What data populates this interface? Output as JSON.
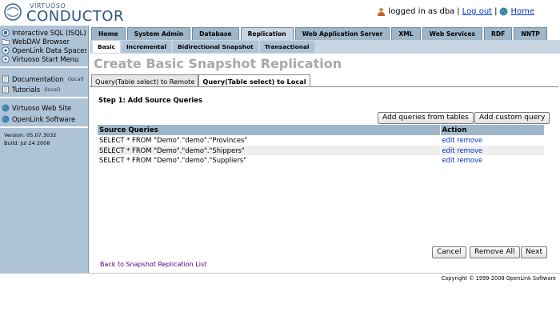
{
  "header": {
    "logo_small": "VIRTUOSO",
    "logo_big": "CONDUCTOR",
    "logged_in_text": "logged in as dba",
    "separator1": "|",
    "logout_label": "Log out",
    "separator2": "|",
    "home_label": "Home"
  },
  "sidebar": {
    "group1": [
      {
        "label": "Interactive SQL (ISQL)",
        "icon": "isql-icon"
      },
      {
        "label": "WebDAV Browser",
        "icon": "folder-icon"
      },
      {
        "label": "OpenLink Data Spaces",
        "icon": "dataspaces-icon"
      },
      {
        "label": "Virtuoso Start Menu",
        "icon": "start-menu-icon"
      }
    ],
    "group2": [
      {
        "label": "Documentation",
        "suffix": "(local)",
        "icon": "docs-icon"
      },
      {
        "label": "Tutorials",
        "suffix": "(local)",
        "icon": "tutorials-icon"
      }
    ],
    "group3": [
      {
        "label": "Virtuoso Web Site",
        "icon": "globe-icon"
      },
      {
        "label": "OpenLink Software",
        "icon": "globe-icon"
      }
    ],
    "version": "Version: 05.07.3032",
    "build": "Build: Jul 24 2008"
  },
  "main_tabs": [
    "Home",
    "System Admin",
    "Database",
    "Replication",
    "Web Application Server",
    "XML",
    "Web Services",
    "RDF",
    "NNTP"
  ],
  "main_tab_active": "Replication",
  "sub_tabs": [
    "Basic",
    "Incremental",
    "Bidirectional Snapshot",
    "Transactional"
  ],
  "sub_tab_active": "Basic",
  "page_title": "Create Basic Snapshot Replication",
  "query_tabs": [
    "Query(Table select) to Remote",
    "Query(Table select) to Local"
  ],
  "query_tab_active": "Query(Table select) to Local",
  "step_label": "Step 1: Add Source Queries",
  "buttons": {
    "add_from_tables": "Add queries from tables",
    "add_custom": "Add custom query",
    "cancel": "Cancel",
    "remove_all": "Remove All",
    "next": "Next"
  },
  "table": {
    "headers": [
      "Source Queries",
      "Action"
    ],
    "rows": [
      {
        "query": "SELECT * FROM \"Demo\".\"demo\".\"Provinces\"",
        "edit": "edit",
        "remove": "remove"
      },
      {
        "query": "SELECT * FROM \"Demo\".\"demo\".\"Shippers\"",
        "edit": "edit",
        "remove": "remove"
      },
      {
        "query": "SELECT * FROM \"Demo\".\"demo\".\"Suppliers\"",
        "edit": "edit",
        "remove": "remove"
      }
    ]
  },
  "back_link": "Back to Snapshot Replication List",
  "copyright": "Copyright © 1999-2008 OpenLink Software",
  "colors": {
    "sidebar_bg": "#aec3d6",
    "tab_bg": "#9fb6c8",
    "subtab_bar": "#c7d6e2",
    "link": "#0033cc",
    "title_gray": "#a9a9a9"
  }
}
